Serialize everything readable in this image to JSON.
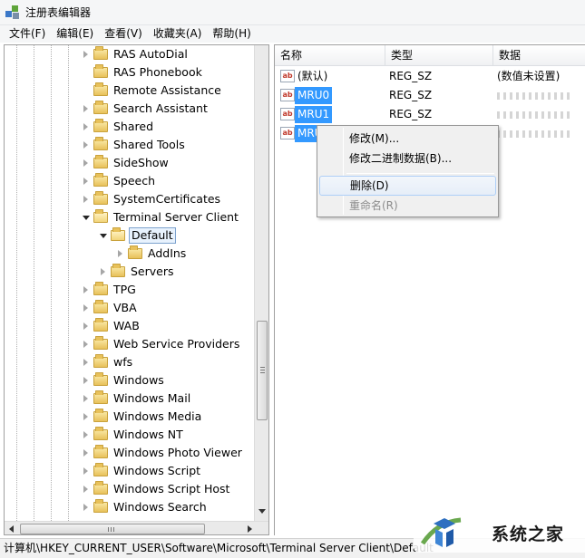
{
  "window": {
    "title": "注册表编辑器"
  },
  "menu": [
    "文件(F)",
    "编辑(E)",
    "查看(V)",
    "收藏夹(A)",
    "帮助(H)"
  ],
  "tree": {
    "items": [
      {
        "label": "RAS AutoDial",
        "level": 0,
        "state": "collapsed"
      },
      {
        "label": "RAS Phonebook",
        "level": 0,
        "state": "none"
      },
      {
        "label": "Remote Assistance",
        "level": 0,
        "state": "none"
      },
      {
        "label": "Search Assistant",
        "level": 0,
        "state": "collapsed"
      },
      {
        "label": "Shared",
        "level": 0,
        "state": "collapsed"
      },
      {
        "label": "Shared Tools",
        "level": 0,
        "state": "collapsed"
      },
      {
        "label": "SideShow",
        "level": 0,
        "state": "collapsed"
      },
      {
        "label": "Speech",
        "level": 0,
        "state": "collapsed"
      },
      {
        "label": "SystemCertificates",
        "level": 0,
        "state": "collapsed"
      },
      {
        "label": "Terminal Server Client",
        "level": 0,
        "state": "expanded"
      },
      {
        "label": "Default",
        "level": 1,
        "state": "expanded",
        "selected": true
      },
      {
        "label": "AddIns",
        "level": 2,
        "state": "collapsed"
      },
      {
        "label": "Servers",
        "level": 1,
        "state": "collapsed"
      },
      {
        "label": "TPG",
        "level": 0,
        "state": "collapsed"
      },
      {
        "label": "VBA",
        "level": 0,
        "state": "collapsed"
      },
      {
        "label": "WAB",
        "level": 0,
        "state": "collapsed"
      },
      {
        "label": "Web Service Providers",
        "level": 0,
        "state": "collapsed"
      },
      {
        "label": "wfs",
        "level": 0,
        "state": "collapsed"
      },
      {
        "label": "Windows",
        "level": 0,
        "state": "collapsed"
      },
      {
        "label": "Windows Mail",
        "level": 0,
        "state": "collapsed"
      },
      {
        "label": "Windows Media",
        "level": 0,
        "state": "collapsed"
      },
      {
        "label": "Windows NT",
        "level": 0,
        "state": "collapsed"
      },
      {
        "label": "Windows Photo Viewer",
        "level": 0,
        "state": "collapsed"
      },
      {
        "label": "Windows Script",
        "level": 0,
        "state": "collapsed"
      },
      {
        "label": "Windows Script Host",
        "level": 0,
        "state": "collapsed"
      },
      {
        "label": "Windows Search",
        "level": 0,
        "state": "collapsed"
      }
    ],
    "scrollbar_icon": "≡"
  },
  "values": {
    "columns": [
      "名称",
      "类型",
      "数据"
    ],
    "rows": [
      {
        "name": "(默认)",
        "type": "REG_SZ",
        "data": "(数值未设置)",
        "selected": false,
        "obscured": false,
        "icon": "ab"
      },
      {
        "name": "MRU0",
        "type": "REG_SZ",
        "data": "",
        "selected": true,
        "obscured": true,
        "icon": "ab"
      },
      {
        "name": "MRU1",
        "type": "REG_SZ",
        "data": "",
        "selected": true,
        "obscured": true,
        "icon": "ab"
      },
      {
        "name": "MRU",
        "type": "",
        "data": "",
        "selected": true,
        "obscured": true,
        "icon": "ab"
      }
    ]
  },
  "context_menu": {
    "items": [
      {
        "label": "修改(M)...",
        "disabled": false
      },
      {
        "label": "修改二进制数据(B)...",
        "disabled": false
      },
      {
        "label": "删除(D)",
        "disabled": false,
        "highlighted": true
      },
      {
        "label": "重命名(R)",
        "disabled": true
      }
    ]
  },
  "status": {
    "path": "计算机\\HKEY_CURRENT_USER\\Software\\Microsoft\\Terminal Server Client\\Default"
  },
  "watermark": {
    "text": "系统之家"
  },
  "colors": {
    "selection": "#3399ff",
    "annotation": "#1c2fa8"
  }
}
